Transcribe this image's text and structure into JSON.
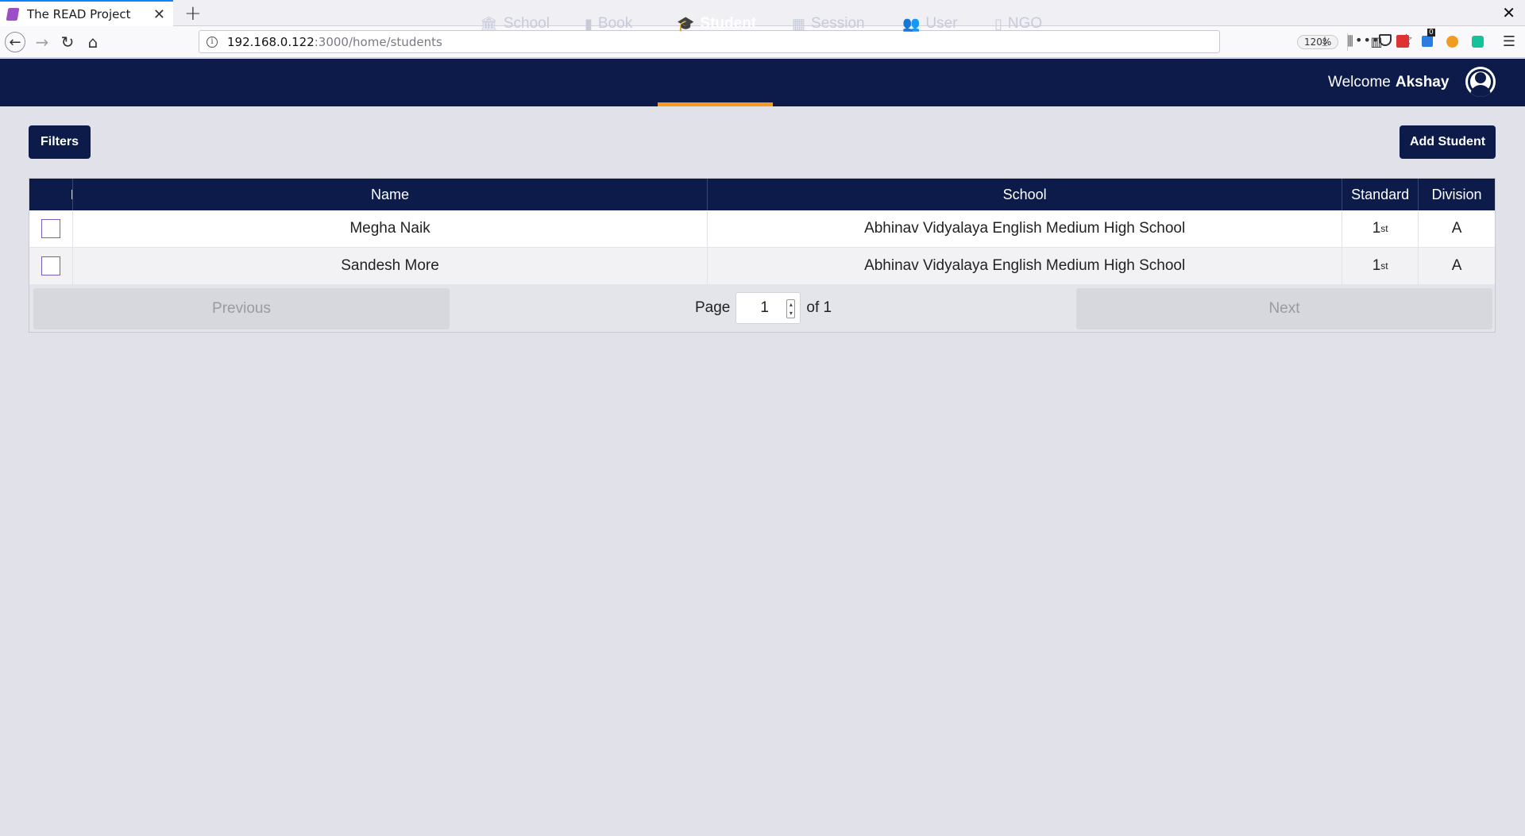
{
  "browser": {
    "tab_title": "The READ Project",
    "url_host": "192.168.0.122",
    "url_path": ":3000/home/students",
    "zoom": "120%",
    "badge_count": "0"
  },
  "nav": {
    "items": [
      {
        "label": "School",
        "icon": "bank-icon",
        "active": false
      },
      {
        "label": "Book",
        "icon": "book-icon",
        "active": false
      },
      {
        "label": "Student",
        "icon": "graduation-cap-icon",
        "active": true
      },
      {
        "label": "Session",
        "icon": "calendar-icon",
        "active": false
      },
      {
        "label": "User",
        "icon": "users-icon",
        "active": false
      },
      {
        "label": "NGO",
        "icon": "building-icon",
        "active": false
      }
    ],
    "welcome_prefix": "Welcome",
    "user_name": "Akshay"
  },
  "toolbar": {
    "filters_label": "Filters",
    "add_label": "Add Student"
  },
  "table": {
    "headers": {
      "name": "Name",
      "school": "School",
      "standard": "Standard",
      "division": "Division"
    },
    "rows": [
      {
        "name": "Megha Naik",
        "school": "Abhinav Vidyalaya English Medium High School",
        "standard": "1",
        "standard_suffix": "st",
        "division": "A"
      },
      {
        "name": "Sandesh More",
        "school": "Abhinav Vidyalaya English Medium High School",
        "standard": "1",
        "standard_suffix": "st",
        "division": "A"
      }
    ]
  },
  "pager": {
    "previous": "Previous",
    "next": "Next",
    "page_label": "Page",
    "page_value": "1",
    "of_label": "of 1"
  },
  "colors": {
    "brand": "#0d1b4b",
    "accent": "#f39a1f",
    "background": "#e1e2e9"
  }
}
